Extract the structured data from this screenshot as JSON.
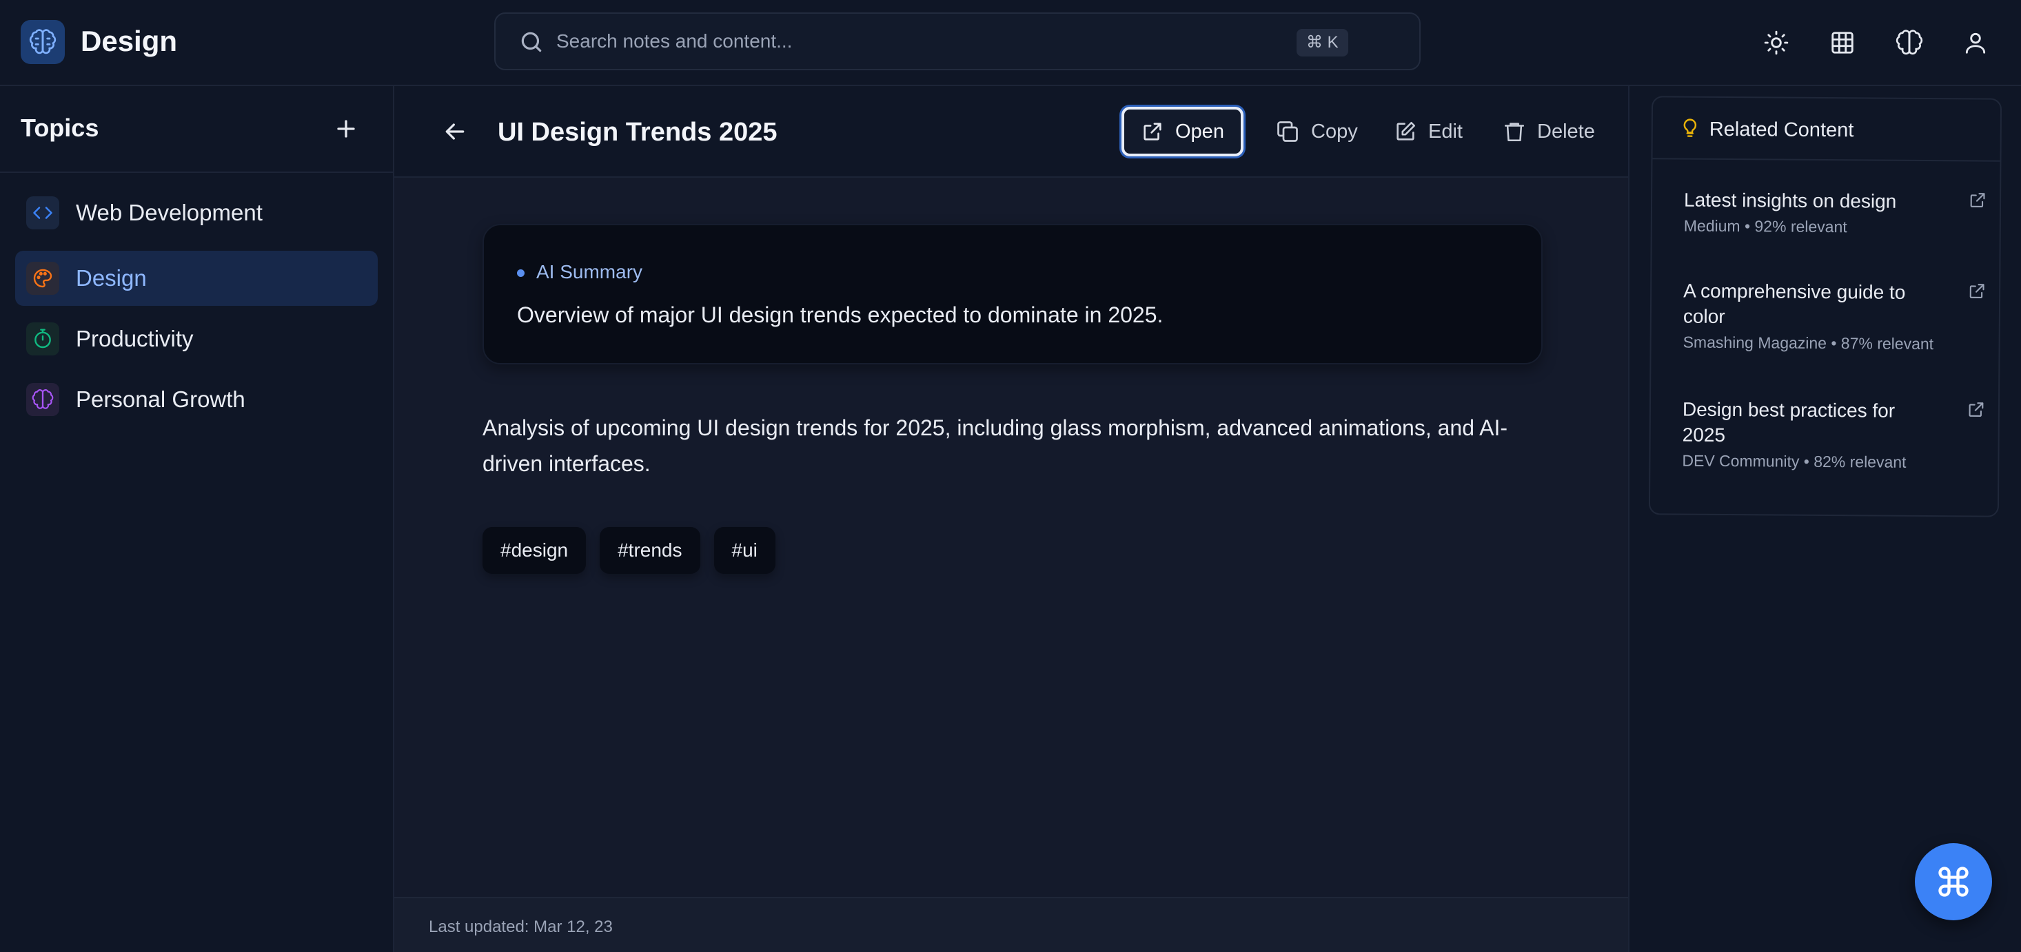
{
  "header": {
    "app_title": "Design",
    "search_placeholder": "Search notes and content...",
    "search_shortcut": "⌘ K",
    "icons": [
      "brain-logo-icon",
      "search-icon",
      "sun-icon",
      "grid-icon",
      "brain-icon",
      "user-icon"
    ]
  },
  "sidebar": {
    "title": "Topics",
    "items": [
      {
        "label": "Web Development",
        "icon": "code-icon",
        "color": "#3b82f6",
        "active": false
      },
      {
        "label": "Design",
        "icon": "palette-icon",
        "color": "#f97316",
        "active": true
      },
      {
        "label": "Productivity",
        "icon": "timer-icon",
        "color": "#10b981",
        "active": false
      },
      {
        "label": "Personal Growth",
        "icon": "brain-icon",
        "color": "#a855f7",
        "active": false
      }
    ]
  },
  "main": {
    "title": "UI Design Trends 2025",
    "actions": {
      "open": "Open",
      "copy": "Copy",
      "edit": "Edit",
      "delete": "Delete"
    },
    "summary_label": "AI Summary",
    "summary_text": "Overview of major UI design trends expected to dominate in 2025.",
    "body": "Analysis of upcoming UI design trends for 2025, including glass morphism, advanced animations, and AI-driven interfaces.",
    "tags": [
      "#design",
      "#trends",
      "#ui"
    ],
    "footer": "Last updated: Mar 12, 23"
  },
  "related": {
    "title": "Related Content",
    "items": [
      {
        "title": "Latest insights on design",
        "meta": "Medium • 92% relevant"
      },
      {
        "title": "A comprehensive guide to color",
        "meta": "Smashing Magazine • 87% relevant"
      },
      {
        "title": "Design best practices for 2025",
        "meta": "DEV Community • 82% relevant"
      }
    ]
  },
  "colors": {
    "accent": "#3b82f6",
    "background": "#0f1525",
    "card": "#080c16",
    "bulb": "#eab308"
  }
}
